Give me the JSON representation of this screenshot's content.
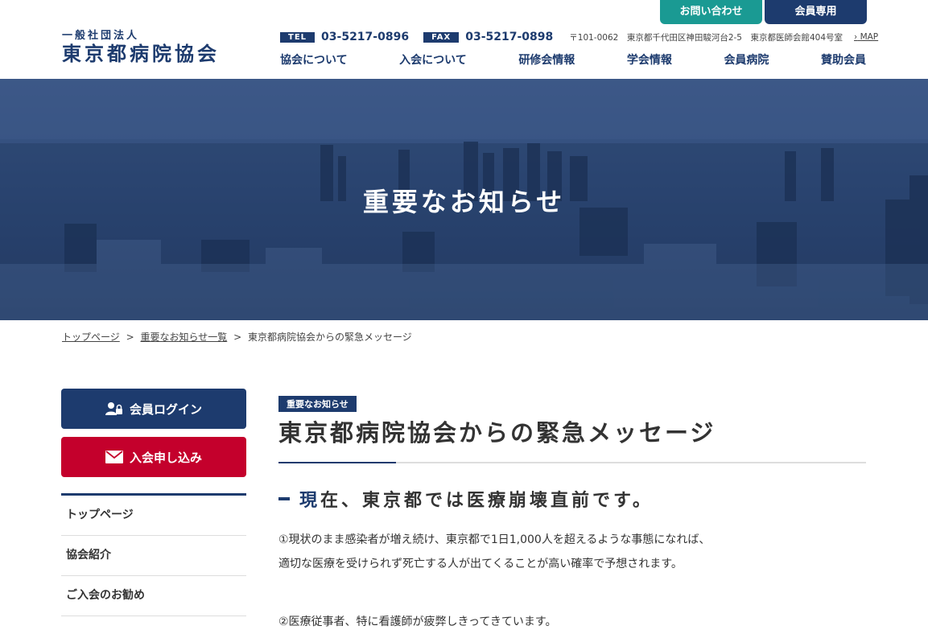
{
  "header": {
    "contact_label": "お問い合わせ",
    "member_label": "会員専用",
    "logo_sub": "一般社団法人",
    "logo_main": "東京都病院協会",
    "tel_tag": "TEL",
    "tel": "03-5217-0896",
    "fax_tag": "FAX",
    "fax": "03-5217-0898",
    "address": "〒101-0062　東京都千代田区神田駿河台2-5　東京都医師会館404号室",
    "map_label": "MAP",
    "nav": [
      "協会について",
      "入会について",
      "研修会情報",
      "学会情報",
      "会員病院",
      "賛助会員"
    ]
  },
  "hero": {
    "title": "重要なお知らせ"
  },
  "breadcrumb": {
    "items": [
      "トップページ",
      "重要なお知らせ一覧",
      "東京都病院協会からの緊急メッセージ"
    ],
    "separator": ">"
  },
  "sidebar": {
    "login_label": "会員ログイン",
    "join_label": "入会申し込み",
    "items": [
      "トップページ",
      "協会紹介",
      "ご入会のお勧め"
    ]
  },
  "main": {
    "category": "重要なお知らせ",
    "title": "東京都病院協会からの緊急メッセージ",
    "section_first_char": "現",
    "section_rest": "在、東京都では医療崩壊直前です。",
    "para1_line1": "①現状のまま感染者が増え続け、東京都で1日1,000人を超えるような事態になれば、",
    "para1_line2": "適切な医療を受けられず死亡する人が出てくることが高い確率で予想されます。",
    "para2_line1": "②医療従事者、特に看護師が疲弊しきってきています。"
  },
  "colors": {
    "navy": "#1d3b6e",
    "teal": "#1a9a93",
    "red": "#c4002c"
  }
}
